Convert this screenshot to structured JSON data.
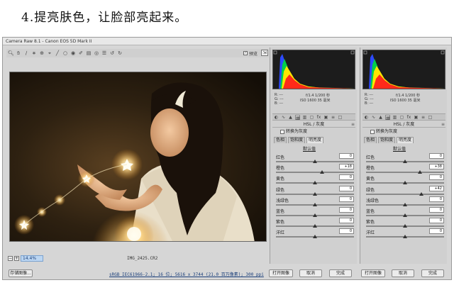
{
  "heading": "4.提亮肤色，让脸部亮起来。",
  "window": {
    "title": "Camera Raw 8.1 -  Canon EOS 5D Mark II"
  },
  "toolbar": {
    "tools": [
      "zoom-icon",
      "hand-icon",
      "white-balance-icon",
      "color-sampler-icon",
      "target-adjust-icon",
      "crop-icon",
      "straighten-icon",
      "spot-removal-icon",
      "red-eye-icon",
      "adjustment-brush-icon",
      "graduated-filter-icon",
      "radial-filter-icon",
      "preferences-icon",
      "rotate-ccw-icon",
      "rotate-cw-icon"
    ],
    "preview_label": "预览",
    "preview_checked": "✓"
  },
  "statusbar": {
    "zoom": "14.4%",
    "filename": "IMG_2425.CR2"
  },
  "bottombar": {
    "save_label": "存储图像...",
    "info": "sRGB IEC61966-2.1; 16 位; 5616 x 3744 (21.0 百万像素); 300 ppi",
    "open_label": "打开图像",
    "cancel_label": "取消",
    "done_label": "完成"
  },
  "panels": [
    {
      "readout": {
        "r": "R:  ---",
        "g": "G:  ---",
        "b": "B:  ---",
        "exif1": "f/1.4   1/200 秒",
        "exif2": "ISO 1600    35 毫米"
      },
      "section_title": "HSL / 灰度",
      "gray_label": "转换为灰度",
      "subtabs": [
        "色相",
        "饱和度",
        "明亮度"
      ],
      "active_subtab": 2,
      "default_label": "默认值",
      "sliders": [
        {
          "label": "红色",
          "value": "0",
          "level": 0
        },
        {
          "label": "橙色",
          "value": "+18",
          "level": 18
        },
        {
          "label": "黄色",
          "value": "0",
          "level": 0
        },
        {
          "label": "绿色",
          "value": "0",
          "level": 0
        },
        {
          "label": "浅绿色",
          "value": "0",
          "level": 0
        },
        {
          "label": "蓝色",
          "value": "0",
          "level": 0
        },
        {
          "label": "紫色",
          "value": "0",
          "level": 0
        },
        {
          "label": "洋红",
          "value": "0",
          "level": 0
        }
      ],
      "buttons": {
        "open_label": "打开图像",
        "cancel_label": "取消",
        "done_label": "完成"
      }
    },
    {
      "readout": {
        "r": "R:  ---",
        "g": "G:  ---",
        "b": "B:  ---",
        "exif1": "f/1.4   1/200 秒",
        "exif2": "ISO 1600    35 毫米"
      },
      "section_title": "HSL / 灰度",
      "gray_label": "转换为灰度",
      "subtabs": [
        "色相",
        "饱和度",
        "明亮度"
      ],
      "active_subtab": 2,
      "default_label": "默认值",
      "sliders": [
        {
          "label": "红色",
          "value": "0",
          "level": 0
        },
        {
          "label": "橙色",
          "value": "+38",
          "level": 38
        },
        {
          "label": "黄色",
          "value": "0",
          "level": 0
        },
        {
          "label": "绿色",
          "value": "+42",
          "level": 42
        },
        {
          "label": "浅绿色",
          "value": "0",
          "level": 0
        },
        {
          "label": "蓝色",
          "value": "0",
          "level": 0
        },
        {
          "label": "紫色",
          "value": "0",
          "level": 0
        },
        {
          "label": "洋红",
          "value": "0",
          "level": 0
        }
      ],
      "buttons": {
        "open_label": "打开图像",
        "cancel_label": "取消",
        "done_label": "完成"
      }
    }
  ],
  "panel_tabs": [
    "basic-icon",
    "tone-curve-icon",
    "detail-icon",
    "hsl-icon",
    "split-toning-icon",
    "lens-icon",
    "effects-icon",
    "camera-calibration-icon",
    "presets-icon",
    "snapshots-icon"
  ]
}
